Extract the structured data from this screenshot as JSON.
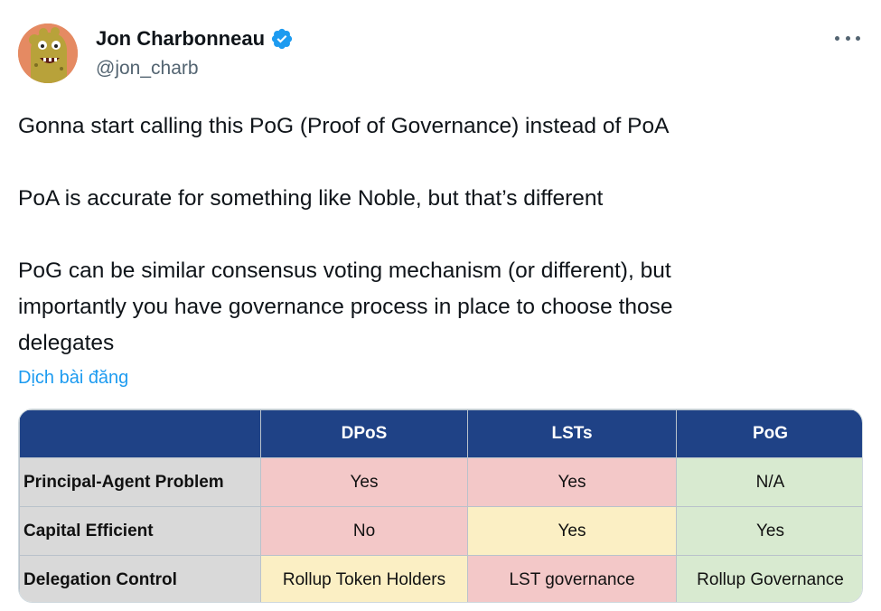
{
  "tweet": {
    "author": {
      "display_name": "Jon Charbonneau",
      "handle": "@jon_charb",
      "verified": true,
      "avatar_icon": "cartoon-avatar-icon"
    },
    "paragraphs": [
      "Gonna start calling this PoG (Proof of Governance) instead of PoA",
      "PoA is accurate for something like Noble, but that’s different",
      "PoG can be similar consensus voting mechanism (or different), but",
      "importantly you have governance process in place to choose those",
      "delegates"
    ],
    "translate_label": "Dịch bài đăng",
    "more_icon": "more-horizontal-icon"
  },
  "table": {
    "headers": [
      "",
      "DPoS",
      "LSTs",
      "PoG"
    ],
    "rows": [
      {
        "label": "Principal-Agent Problem",
        "cells": [
          "Yes",
          "Yes",
          "N/A"
        ],
        "colors": [
          "red",
          "red",
          "green"
        ]
      },
      {
        "label": "Capital Efficient",
        "cells": [
          "No",
          "Yes",
          "Yes"
        ],
        "colors": [
          "red",
          "yellow",
          "green"
        ]
      },
      {
        "label": "Delegation Control",
        "cells": [
          "Rollup Token Holders",
          "LST governance",
          "Rollup Governance"
        ],
        "colors": [
          "yellow",
          "red",
          "green"
        ]
      }
    ],
    "palette": {
      "header": "#1f4286",
      "red": "#f3c8c8",
      "yellow": "#fbefc4",
      "green": "#d8ead0",
      "label": "#d9d9d9"
    }
  },
  "colors": {
    "link": "#1d9bf0",
    "verified": "#1d9bf0",
    "text": "#0f1419",
    "muted": "#536471"
  }
}
